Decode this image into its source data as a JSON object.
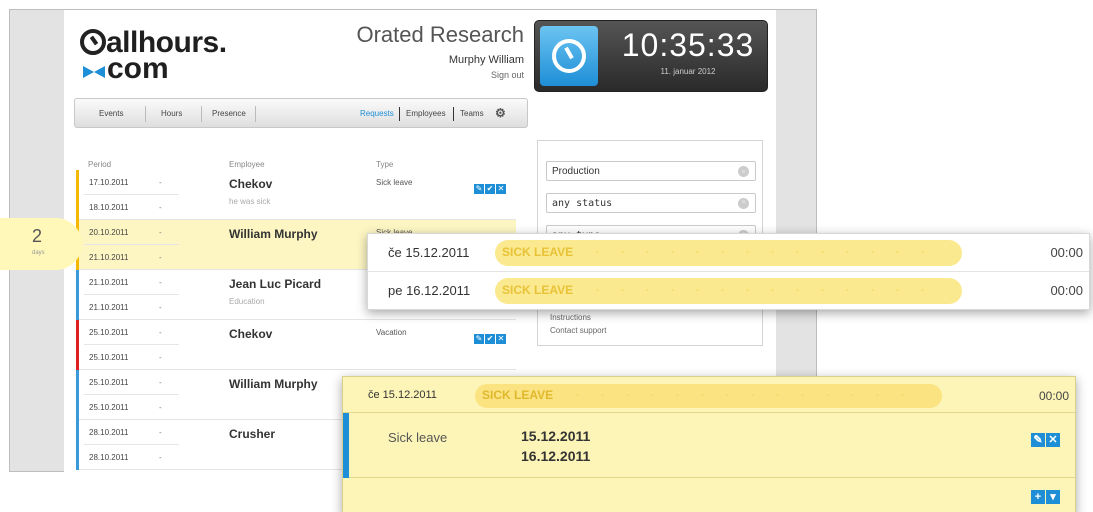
{
  "brand": {
    "line1": "allhours.",
    "line2": "com"
  },
  "header": {
    "company": "Orated Research",
    "user": "Murphy William",
    "signout": "Sign out",
    "time": "10:35:33",
    "date": "11. januar 2012"
  },
  "nav": {
    "left": [
      "Events",
      "Hours",
      "Presence"
    ],
    "right": [
      "Requests",
      "Employees",
      "Teams"
    ]
  },
  "columns": {
    "period": "Period",
    "employee": "Employee",
    "type": "Type"
  },
  "rows": [
    {
      "from": "17.10.2011",
      "to": "18.10.2011",
      "dash": "-",
      "employee": "Chekov",
      "note": "he was sick",
      "type": "Sick leave",
      "color": "#f5b800"
    },
    {
      "from": "20.10.2011",
      "to": "21.10.2011",
      "dash": "-",
      "employee": "William Murphy",
      "note": "",
      "type": "Sick leave",
      "color": "#f5b800"
    },
    {
      "from": "21.10.2011",
      "to": "21.10.2011",
      "dash": "-",
      "employee": "Jean Luc Picard",
      "note": "Education",
      "type": "",
      "color": "#3a9ad9"
    },
    {
      "from": "25.10.2011",
      "to": "25.10.2011",
      "dash": "-",
      "employee": "Chekov",
      "note": "",
      "type": "Vacation",
      "color": "#e02020"
    },
    {
      "from": "25.10.2011",
      "to": "25.10.2011",
      "dash": "-",
      "employee": "William Murphy",
      "note": "",
      "type": "",
      "color": "#3a9ad9"
    },
    {
      "from": "28.10.2011",
      "to": "28.10.2011",
      "dash": "-",
      "employee": "Crusher",
      "note": "",
      "type": "",
      "color": "#3a9ad9"
    }
  ],
  "filters": [
    "Production",
    "any status",
    "any type"
  ],
  "links": [
    "Instructions",
    "Contact support"
  ],
  "days": {
    "count": "2",
    "label": "days"
  },
  "popup1": [
    {
      "day": "če  15.12.2011",
      "label": "SICK LEAVE",
      "time": "00:00"
    },
    {
      "day": "pe  16.12.2011",
      "label": "SICK LEAVE",
      "time": "00:00"
    }
  ],
  "popup2": {
    "day": "če  15.12.2011",
    "label": "SICK LEAVE",
    "time": "00:00",
    "type": "Sick leave",
    "date1": "15.12.2011",
    "date2": "16.12.2011"
  },
  "colors": {
    "accent": "#1e8ed6",
    "sick": "#fbe98f",
    "highlight": "#fdf5b8"
  }
}
